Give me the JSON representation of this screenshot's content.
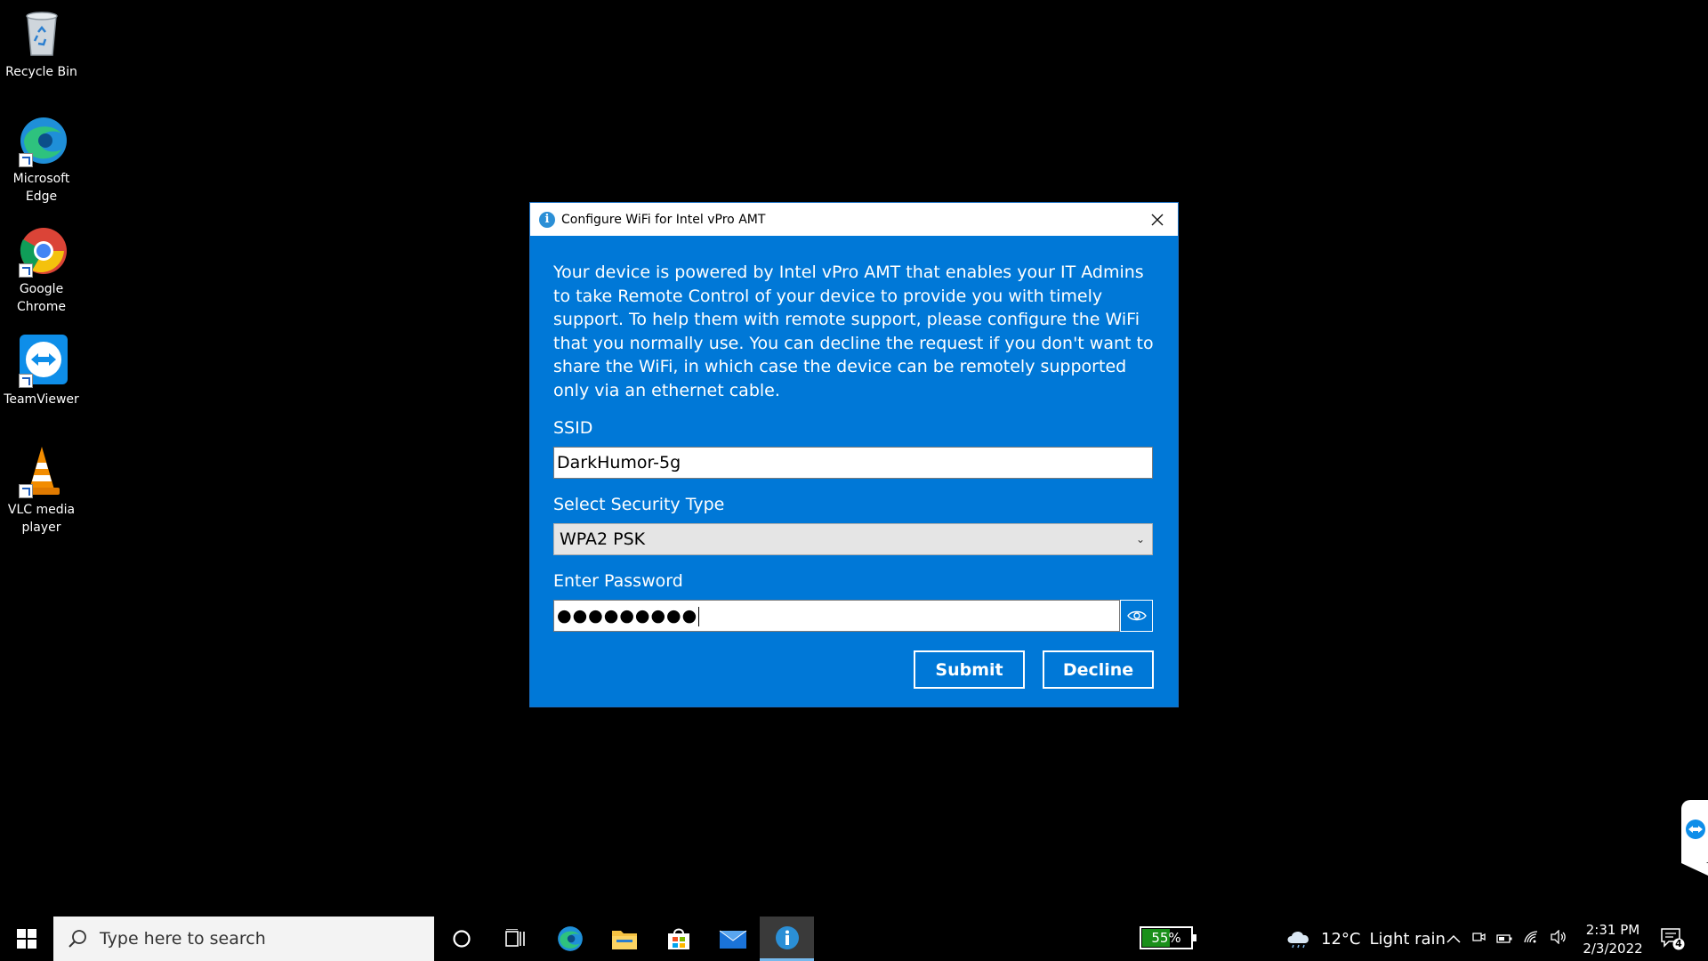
{
  "desktop": {
    "icons": [
      {
        "label": "Recycle Bin"
      },
      {
        "label": "Microsoft Edge"
      },
      {
        "label": "Google Chrome"
      },
      {
        "label": "TeamViewer"
      },
      {
        "label": "VLC media player"
      }
    ]
  },
  "dialog": {
    "title": "Configure WiFi for Intel vPro AMT",
    "description": "Your device is powered by Intel vPro AMT that enables your IT Admins to take Remote Control of your device to provide you with timely support. To help them with remote support, please configure the WiFi that you normally use. You can decline the request if you don't want to share the WiFi, in which case the device can be remotely supported only via an ethernet cable.",
    "ssid_label": "SSID",
    "ssid_value": "DarkHumor-5g",
    "security_label": "Select Security Type",
    "security_value": "WPA2 PSK",
    "password_label": "Enter Password",
    "password_mask": "●●●●●●●●●",
    "submit_label": "Submit",
    "decline_label": "Decline"
  },
  "taskbar": {
    "search_placeholder": "Type here to search",
    "battery_text": "55%",
    "battery_level": 0.55,
    "weather_temp": "12°C",
    "weather_desc": "Light rain",
    "time": "2:31 PM",
    "date": "2/3/2022",
    "notification_count": "4"
  },
  "colors": {
    "dialog_blue": "#0078d7",
    "battery_green": "#1a8f1a"
  }
}
